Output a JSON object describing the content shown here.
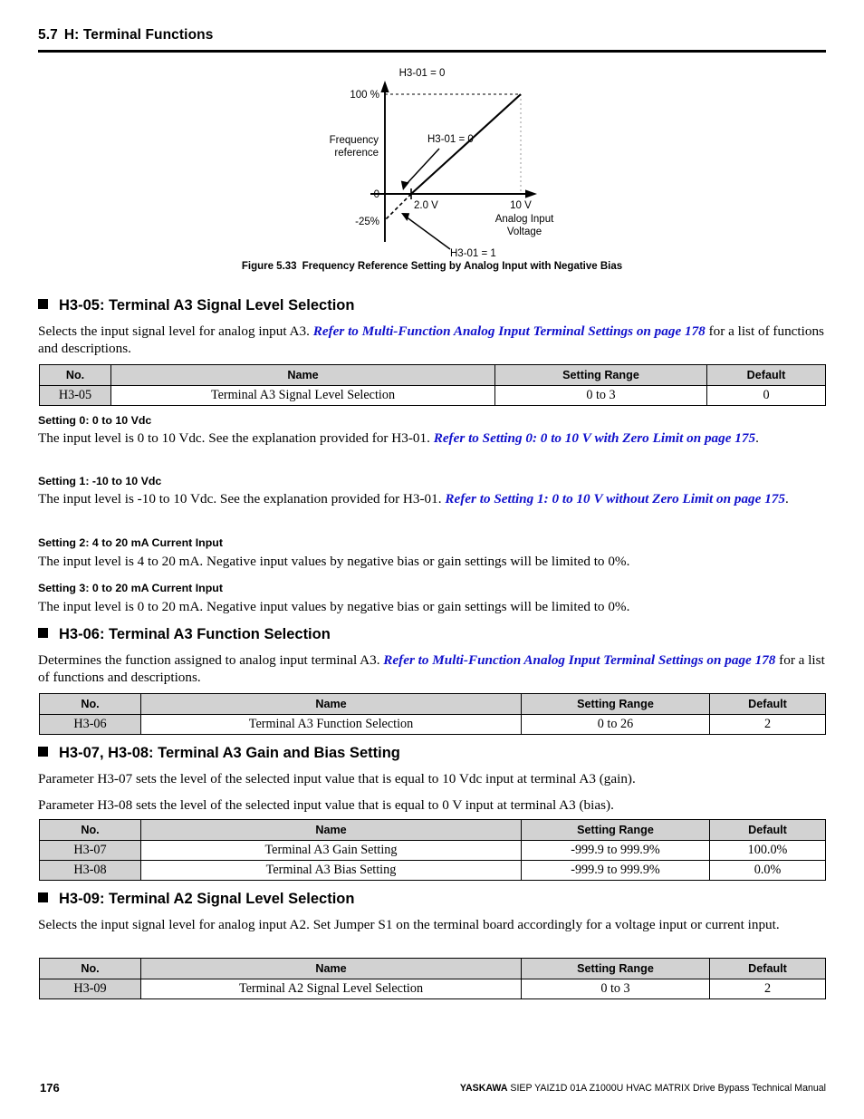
{
  "section": {
    "number": "5.7",
    "title": "H: Terminal Functions"
  },
  "figure": {
    "caption_label": "Figure 5.33",
    "caption_text": "Frequency Reference Setting by Analog Input with Negative Bias",
    "top_label": "H3-01 = 0",
    "y_axis_label_line1": "Frequency",
    "y_axis_label_line2": "reference",
    "y_tick_top": "100 %",
    "y_tick_zero": "0",
    "y_tick_neg": "-25%",
    "x_tick_1": "2.0 V",
    "x_tick_2": "10 V",
    "x_axis_label_line1": "Analog Input",
    "x_axis_label_line2": "Voltage",
    "annotation_upper": "H3-01 = 0",
    "annotation_lower": "H3-01 = 1"
  },
  "chart_data": {
    "type": "line",
    "title": "H3-01 = 0",
    "xlabel": "Analog Input Voltage",
    "ylabel": "Frequency reference",
    "xlim": [
      0,
      11
    ],
    "ylim": [
      -25,
      100
    ],
    "xticks": [
      "2.0 V",
      "10 V"
    ],
    "yticks": [
      "100 %",
      "0",
      "-25%"
    ],
    "grid": false,
    "series": [
      {
        "name": "H3-01 = 0",
        "style": "solid",
        "points": [
          [
            2.0,
            0
          ],
          [
            10.0,
            100
          ]
        ]
      },
      {
        "name": "H3-01 = 1",
        "style": "dashed",
        "points": [
          [
            0.0,
            -25
          ],
          [
            2.0,
            0
          ]
        ]
      }
    ],
    "annotations": [
      "H3-01 = 0",
      "H3-01 = 1"
    ]
  },
  "blocks": [
    {
      "heading": "H3-05: Terminal A3 Signal Level Selection",
      "intro_pre": "Selects the input signal level for analog input A3. ",
      "intro_link": "Refer to Multi-Function Analog Input Terminal Settings on page 178",
      "intro_post": " for a list of functions and descriptions."
    },
    {
      "heading": "H3-06: Terminal A3 Function Selection",
      "intro_pre": "Determines the function assigned to analog input terminal A3. ",
      "intro_link": "Refer to Multi-Function Analog Input Terminal Settings on page 178",
      "intro_post": " for a list of functions and descriptions."
    },
    {
      "heading": "H3-07, H3-08: Terminal A3 Gain and Bias Setting",
      "para1": "Parameter H3-07 sets the level of the selected input value that is equal to 10 Vdc input at terminal A3 (gain).",
      "para2": "Parameter H3-08 sets the level of the selected input value that is equal to 0 V input at terminal A3 (bias)."
    },
    {
      "heading": "H3-09: Terminal A2 Signal Level Selection",
      "intro": "Selects the input signal level for analog input A2. Set Jumper S1 on the terminal board accordingly for a voltage input or current input."
    }
  ],
  "table_headers": [
    "No.",
    "Name",
    "Setting Range",
    "Default"
  ],
  "table1": {
    "rows": [
      {
        "no": "H3-05",
        "name": "Terminal A3 Signal Level Selection",
        "range": "0 to 3",
        "default": "0"
      }
    ]
  },
  "table2": {
    "rows": [
      {
        "no": "H3-06",
        "name": "Terminal A3 Function Selection",
        "range": "0 to 26",
        "default": "2"
      }
    ]
  },
  "table3": {
    "rows": [
      {
        "no": "H3-07",
        "name": "Terminal A3 Gain Setting",
        "range": "-999.9 to 999.9%",
        "default": "100.0%"
      },
      {
        "no": "H3-08",
        "name": "Terminal A3 Bias Setting",
        "range": "-999.9 to 999.9%",
        "default": "0.0%"
      }
    ]
  },
  "table4": {
    "rows": [
      {
        "no": "H3-09",
        "name": "Terminal A2 Signal Level Selection",
        "range": "0 to 3",
        "default": "2"
      }
    ]
  },
  "settings": [
    {
      "heading": "Setting 0: 0 to 10 Vdc",
      "body_pre": "The input level is 0 to 10 Vdc. See the explanation provided for H3-01. ",
      "body_link": "Refer to Setting 0: 0 to 10 V with Zero Limit on page 175",
      "body_post": "."
    },
    {
      "heading": "Setting 1: -10 to 10 Vdc",
      "body_pre": "The input level is -10 to 10 Vdc. See the explanation provided for H3-01. ",
      "body_link": "Refer to Setting 1: 0 to 10 V without Zero Limit on page 175",
      "body_post": "."
    },
    {
      "heading": "Setting 2: 4 to 20 mA Current Input",
      "body_pre": "The input level is 4 to 20 mA. Negative input values by negative bias or gain settings will be limited to 0%.",
      "body_link": "",
      "body_post": ""
    },
    {
      "heading": "Setting 3: 0 to 20 mA Current Input",
      "body_pre": "The input level is 0 to 20 mA. Negative input values by negative bias or gain settings will be limited to 0%.",
      "body_link": "",
      "body_post": ""
    }
  ],
  "footer": {
    "page_number": "176",
    "brand": "YASKAWA",
    "manual": " SIEP YAIZ1D 01A Z1000U HVAC MATRIX Drive Bypass Technical Manual"
  }
}
